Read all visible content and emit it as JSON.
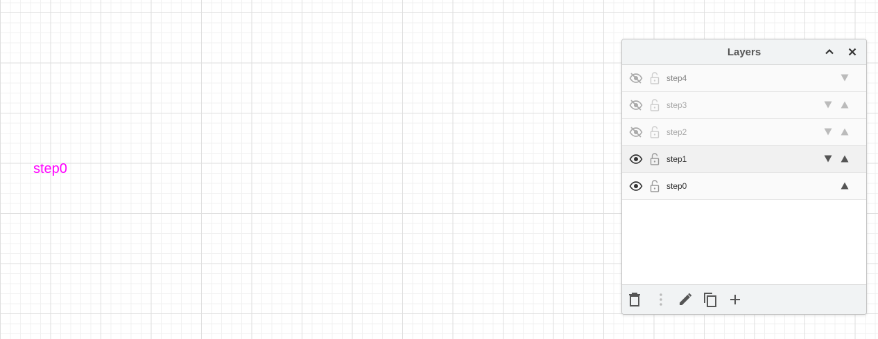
{
  "canvas": {
    "shape_text": "step0",
    "shape_color": "#ff00ff"
  },
  "panel": {
    "title": "Layers",
    "icons": {
      "collapse": "chevron-up-icon",
      "close": "close-icon"
    }
  },
  "layers": [
    {
      "name": "step4",
      "visible": false,
      "locked": false,
      "can_move_down": true,
      "can_move_up": false
    },
    {
      "name": "step3",
      "visible": false,
      "locked": false,
      "can_move_down": true,
      "can_move_up": true
    },
    {
      "name": "step2",
      "visible": false,
      "locked": false,
      "can_move_down": true,
      "can_move_up": true
    },
    {
      "name": "step1",
      "visible": true,
      "locked": false,
      "can_move_down": true,
      "can_move_up": true,
      "selected": true
    },
    {
      "name": "step0",
      "visible": true,
      "locked": false,
      "can_move_down": false,
      "can_move_up": true
    }
  ],
  "footer": {
    "icons": [
      "trash-icon",
      "more-vertical-icon",
      "pencil-icon",
      "duplicate-icon",
      "plus-icon"
    ]
  }
}
